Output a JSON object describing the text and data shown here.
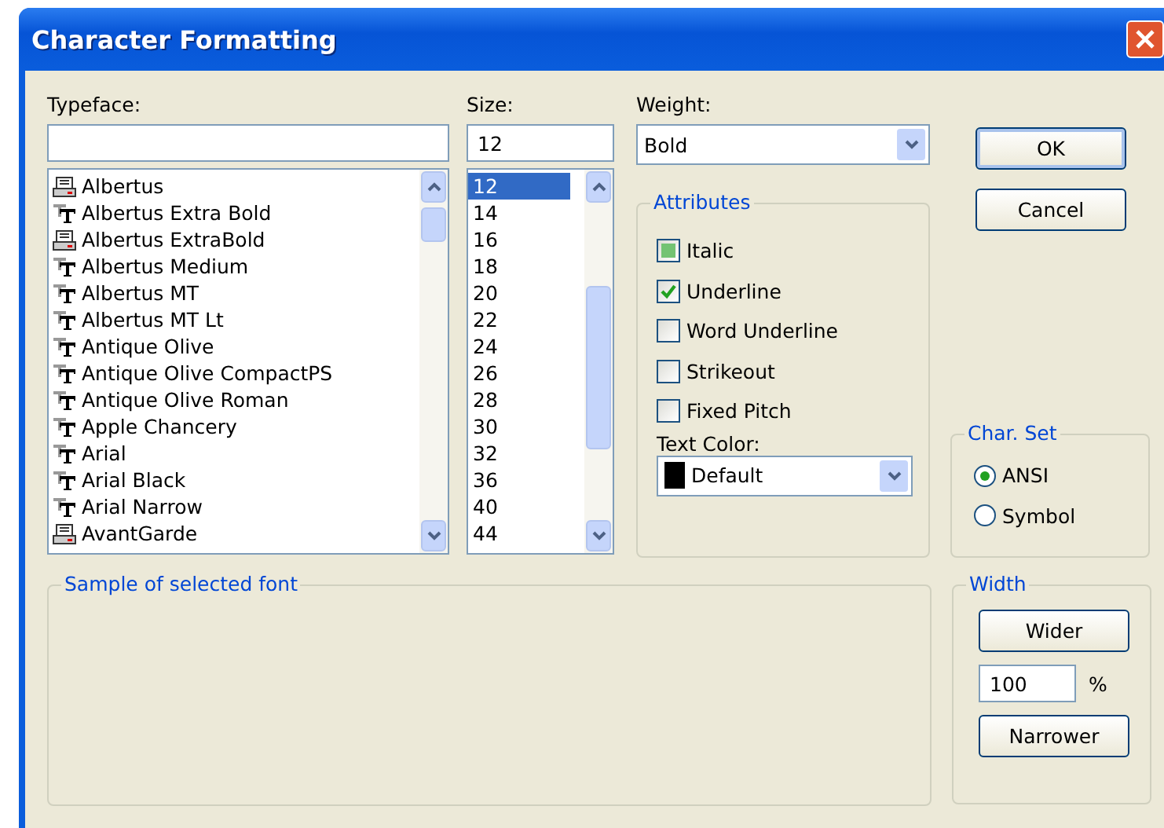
{
  "window": {
    "title": "Character Formatting"
  },
  "typeface": {
    "label": "Typeface:",
    "items": [
      {
        "name": "Albertus",
        "kind": "printer",
        "selected": false
      },
      {
        "name": "Albertus Extra Bold",
        "kind": "truetype",
        "selected": false
      },
      {
        "name": "Albertus ExtraBold",
        "kind": "printer",
        "selected": false
      },
      {
        "name": "Albertus Medium",
        "kind": "truetype",
        "selected": false
      },
      {
        "name": "Albertus MT",
        "kind": "truetype",
        "selected": false
      },
      {
        "name": "Albertus MT Lt",
        "kind": "truetype",
        "selected": false
      },
      {
        "name": "Antique Olive",
        "kind": "truetype",
        "selected": false
      },
      {
        "name": "Antique Olive CompactPS",
        "kind": "truetype",
        "selected": false
      },
      {
        "name": "Antique Olive Roman",
        "kind": "truetype",
        "selected": false
      },
      {
        "name": "Apple Chancery",
        "kind": "truetype",
        "selected": false
      },
      {
        "name": "Arial",
        "kind": "truetype",
        "selected": false
      },
      {
        "name": "Arial Black",
        "kind": "truetype",
        "selected": false
      },
      {
        "name": "Arial Narrow",
        "kind": "truetype",
        "selected": false
      },
      {
        "name": "AvantGarde",
        "kind": "printer",
        "selected": false
      }
    ]
  },
  "size": {
    "label": "Size:",
    "value": "12",
    "items": [
      {
        "name": "12",
        "selected": true
      },
      {
        "name": "14",
        "selected": false
      },
      {
        "name": "16",
        "selected": false
      },
      {
        "name": "18",
        "selected": false
      },
      {
        "name": "20",
        "selected": false
      },
      {
        "name": "22",
        "selected": false
      },
      {
        "name": "24",
        "selected": false
      },
      {
        "name": "26",
        "selected": false
      },
      {
        "name": "28",
        "selected": false
      },
      {
        "name": "30",
        "selected": false
      },
      {
        "name": "32",
        "selected": false
      },
      {
        "name": "36",
        "selected": false
      },
      {
        "name": "40",
        "selected": false
      },
      {
        "name": "44",
        "selected": false
      }
    ]
  },
  "weight": {
    "label": "Weight:",
    "value": "Bold"
  },
  "attributes": {
    "title": "Attributes",
    "items": [
      {
        "label": "Italic",
        "checked": false,
        "indeterminate": true
      },
      {
        "label": "Underline",
        "checked": true,
        "indeterminate": false
      },
      {
        "label": "Word Underline",
        "checked": false,
        "indeterminate": false
      },
      {
        "label": "Strikeout",
        "checked": false,
        "indeterminate": false
      },
      {
        "label": "Fixed Pitch",
        "checked": false,
        "indeterminate": false
      }
    ],
    "text_color": {
      "label": "Text Color:",
      "value": "Default",
      "color": "#000000"
    }
  },
  "buttons": [
    "OK",
    "Cancel"
  ],
  "char_set": {
    "title": "Char. Set",
    "options": [
      {
        "label": "ANSI",
        "selected": true
      },
      {
        "label": "Symbol",
        "selected": false
      }
    ]
  },
  "sample": {
    "title": "Sample of selected font"
  },
  "width": {
    "title": "Width",
    "wider": "Wider",
    "value": "100",
    "unit": "%",
    "narrower": "Narrower"
  }
}
